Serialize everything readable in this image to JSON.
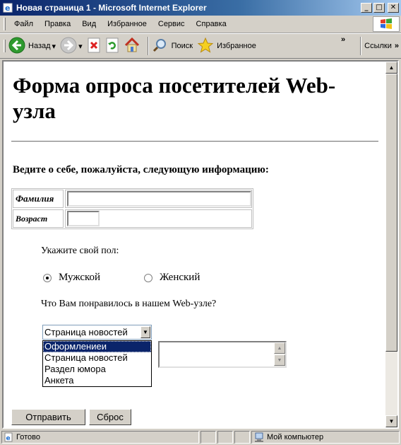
{
  "window": {
    "title": "Новая страница 1 - Microsoft Internet Explorer",
    "controls": {
      "minimize": "_",
      "maximize": "□",
      "close": "✕"
    }
  },
  "menu": {
    "items": [
      "Файл",
      "Правка",
      "Вид",
      "Избранное",
      "Сервис",
      "Справка"
    ]
  },
  "toolbar": {
    "back_label": "Назад",
    "search_label": "Поиск",
    "favorites_label": "Избранное",
    "links_label": "Ссылки",
    "overflow": "»"
  },
  "page": {
    "heading": "Форма опроса посетителей Web-узла",
    "intro": "Ведите о себе, пожалуйста, следующую информацию:",
    "fields": {
      "surname_label": "Фамилия",
      "surname_value": "",
      "age_label": "Возраст",
      "age_value": ""
    },
    "gender_question": "Укажите свой пол:",
    "gender_options": [
      {
        "label": "Мужской",
        "checked": true
      },
      {
        "label": "Женский",
        "checked": false
      }
    ],
    "likes_question": "Что Вам понравилось в нашем Web-узле?",
    "dropdown_selected": "Страница новостей",
    "listbox_options": [
      {
        "label": "Оформлениеи",
        "selected": true
      },
      {
        "label": "Страница новостей",
        "selected": false
      },
      {
        "label": "Раздел юмора",
        "selected": false
      },
      {
        "label": "Анкета",
        "selected": false
      }
    ],
    "comment_value": "",
    "submit_label": "Отправить",
    "reset_label": "Сброс"
  },
  "statusbar": {
    "status": "Готово",
    "zone": "Мой компьютер"
  },
  "colors": {
    "titlebar_start": "#0a246a",
    "titlebar_end": "#a6caf0",
    "chrome": "#d4d0c8",
    "selection": "#0a246a"
  },
  "icons": [
    "ie-icon",
    "windows-logo-icon",
    "back-icon",
    "forward-icon",
    "stop-icon",
    "refresh-icon",
    "home-icon",
    "search-icon",
    "favorites-star-icon",
    "status-page-icon",
    "computer-icon"
  ]
}
